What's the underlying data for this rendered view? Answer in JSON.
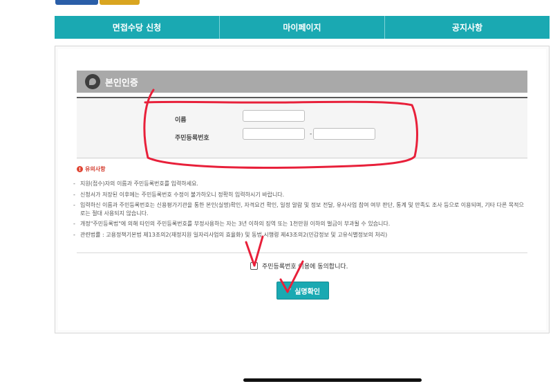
{
  "nav": {
    "tabs": [
      {
        "label": "면접수당 신청"
      },
      {
        "label": "마이페이지"
      },
      {
        "label": "공지사항"
      }
    ]
  },
  "section": {
    "title": "본인인증"
  },
  "form": {
    "name_label": "이름",
    "name_value": "",
    "rrn_label": "주민등록번호",
    "rrn_front_value": "",
    "rrn_back_value": "",
    "rrn_separator": "-"
  },
  "notice": {
    "title": "유의사항",
    "items": [
      "지원(접수)자의 이름과 주민등록번호를 입력하세요.",
      "신청서가 저장된 이후에는 주민등록번호 수정이 불가하오니 정확히 입력하시기 바랍니다.",
      "입력하신 이름과 주민등록번호는 신용평가기관을 통한 본인(실명)확인, 자격요건 확인, 일정 알람 및 정보 전달, 유사사업 참여 여부 판단, 통계 및 만족도 조사 등으로 이용되며, 기타 다른 목적으로는 절대 사용되지 않습니다.",
      "개정\"주민등록법\"에 의해 타인의 주민등록번호를 부정사용하는 자는 3년 이하의 징역 또는 1천만원 이하의 벌금이 부과될 수 있습니다.",
      "관련법률 : 고용정책기본법 제13조의2(재정지원 일자리사업의 효율화) 및 동법 시행령 제43조의2(민감정보 및 고유식별정보의 처리)"
    ]
  },
  "consent": {
    "label": "주민등록번호 이용에 동의합니다.",
    "checked": false
  },
  "confirm_button": {
    "label": "실명확인"
  },
  "colors": {
    "nav_bg": "#1aa9b2",
    "section_head_bg": "#a9a9a9",
    "notice_red": "#d43d2f",
    "annotation_red": "#e8203a"
  }
}
